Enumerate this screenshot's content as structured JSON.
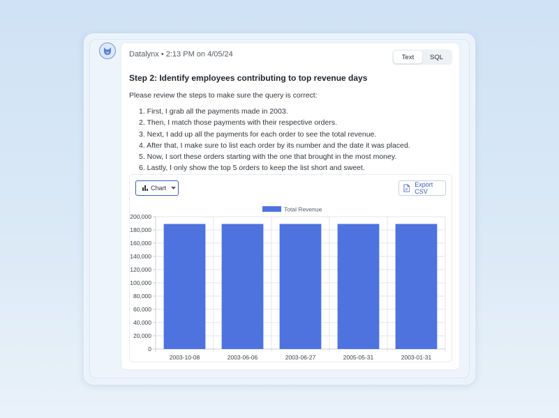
{
  "message": {
    "author": "Datalynx",
    "timestamp": "2:13 PM on 4/05/24",
    "meta_text": "Datalynx • 2:13 PM on 4/05/24",
    "view_toggle": {
      "options": [
        "Text",
        "SQL"
      ],
      "selected": "Text"
    },
    "step_title": "Step 2: Identify employees contributing to top revenue days",
    "intro": "Please review the steps to make sure the query is correct:",
    "steps": [
      "1. First, I grab all the payments made in 2003.",
      "2. Then, I match those payments with their respective orders.",
      "3. Next, I add up all the payments for each order to see the total revenue.",
      "4. After that, I make sure to list each order by its number and the date it was placed.",
      "5. Now, I sort these orders starting with the one that brought in the most money.",
      "6. Lastly, I only show the top 5 orders to keep the list short and sweet."
    ]
  },
  "chart_panel": {
    "view_selector": {
      "label": "Chart",
      "icon": "bar-chart-icon"
    },
    "export": {
      "label": "Export CSV",
      "icon": "file-icon"
    }
  },
  "colors": {
    "bar": "#4e73df",
    "accent": "#3a5bb5"
  },
  "chart_data": {
    "type": "bar",
    "categories": [
      "2003-10-08",
      "2003-06-06",
      "2003-06-27",
      "2005-05-31",
      "2003-01-31"
    ],
    "series": [
      {
        "name": "Total Revenue",
        "values": [
          189000,
          189000,
          189000,
          189000,
          189000
        ]
      }
    ],
    "ylim": [
      0,
      200000
    ],
    "yticks": [
      0,
      20000,
      40000,
      60000,
      80000,
      100000,
      120000,
      140000,
      160000,
      180000,
      200000
    ],
    "ytick_labels": [
      "0",
      "20,000",
      "40,000",
      "60,000",
      "80,000",
      "100,000",
      "120,000",
      "140,000",
      "160,000",
      "180,000",
      "200,000"
    ],
    "grid": true,
    "legend": "top-center"
  }
}
